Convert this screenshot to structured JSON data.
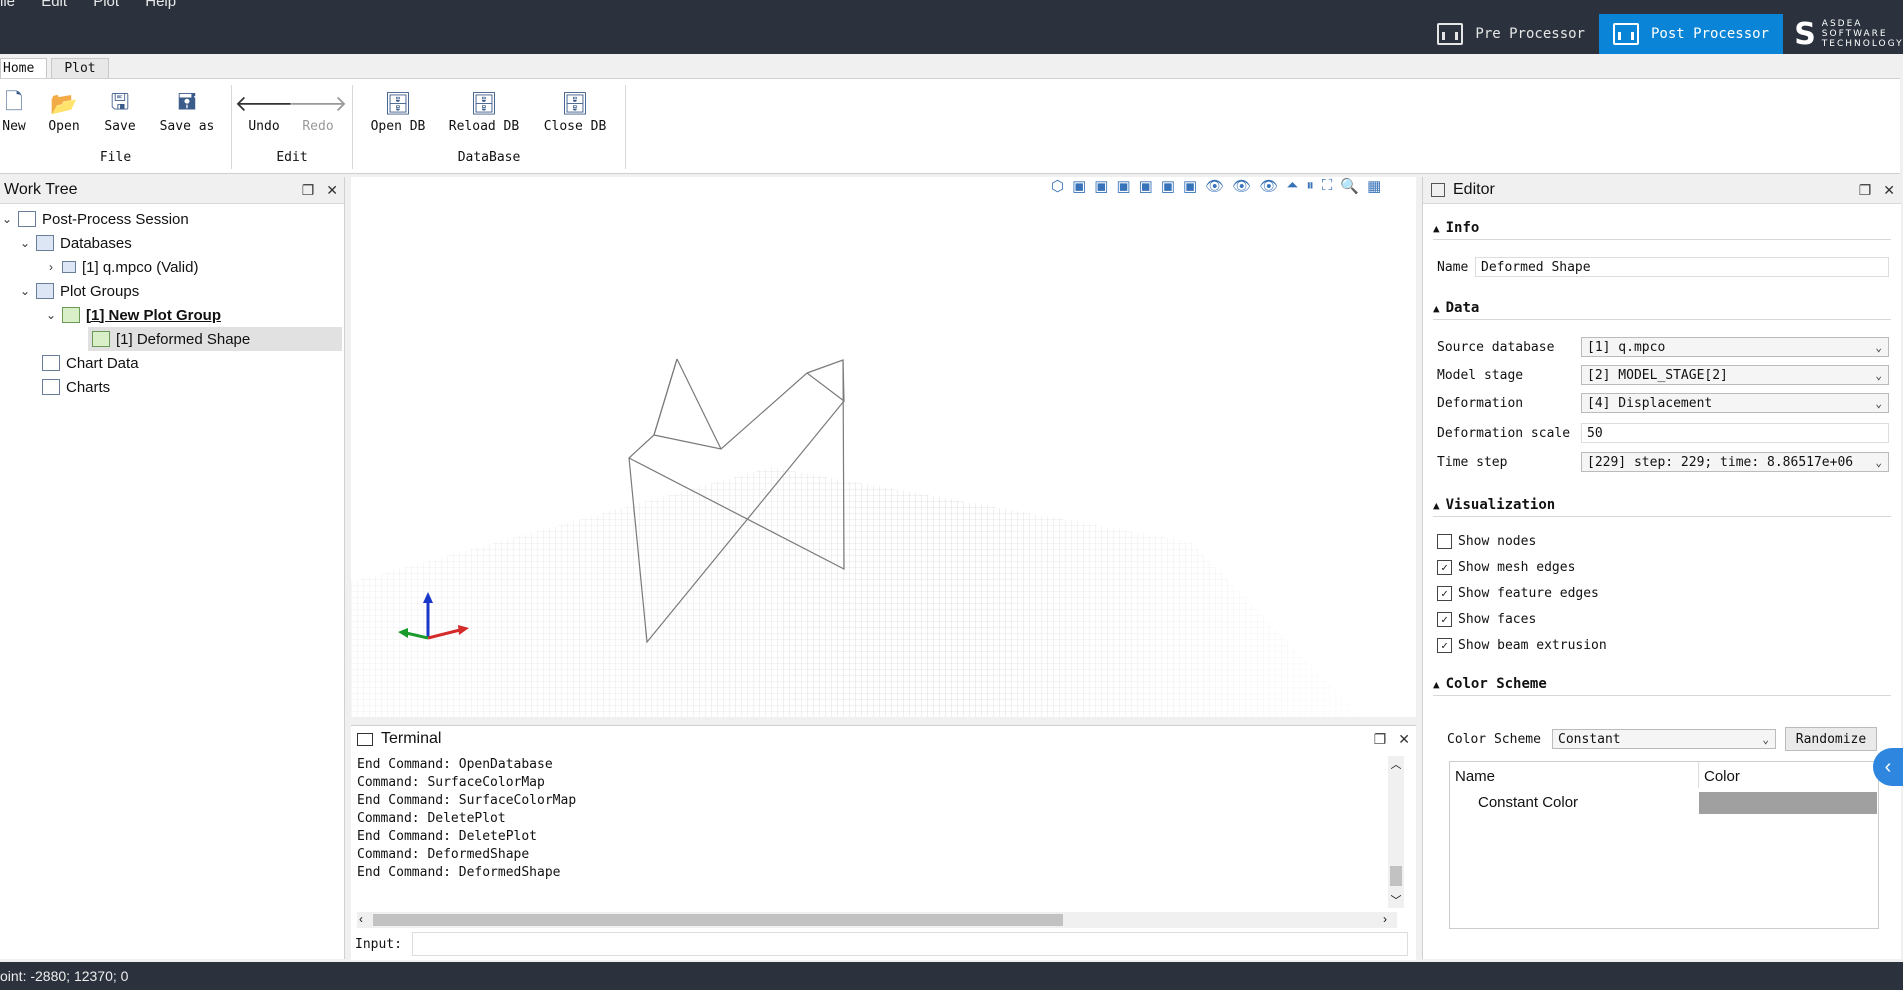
{
  "menu": [
    "ile",
    "Edit",
    "Plot",
    "Help"
  ],
  "processors": {
    "pre": "Pre Processor",
    "post": "Post Processor",
    "logo_text": "ASDEA SOFTWARE TECHNOLOGY"
  },
  "ribbon_tabs": [
    "Home",
    "Plot"
  ],
  "ribbon": {
    "file_group": "File",
    "edit_group": "Edit",
    "db_group": "DataBase",
    "new": "New",
    "open": "Open",
    "save": "Save",
    "save_as": "Save as",
    "undo": "Undo",
    "redo": "Redo",
    "open_db": "Open DB",
    "reload_db": "Reload DB",
    "close_db": "Close DB"
  },
  "worktree": {
    "title": "Work Tree",
    "session": "Post-Process Session",
    "databases": "Databases",
    "db_item": "[1] q.mpco (Valid)",
    "plot_groups": "Plot Groups",
    "plot_group": "[1] New Plot Group",
    "plot": "[1] Deformed Shape",
    "chart_data": "Chart Data",
    "charts": "Charts"
  },
  "terminal": {
    "title": "Terminal",
    "lines": [
      "End Command: OpenDatabase",
      "Command: SurfaceColorMap",
      "End Command: SurfaceColorMap",
      "Command: DeletePlot",
      "End Command: DeletePlot",
      "Command: DeformedShape",
      "End Command: DeformedShape"
    ],
    "input_label": "Input:"
  },
  "editor": {
    "title": "Editor",
    "info": "Info",
    "name_label": "Name",
    "name_value": "Deformed Shape",
    "data": "Data",
    "source_db_label": "Source database",
    "source_db_value": "[1] q.mpco",
    "model_stage_label": "Model stage",
    "model_stage_value": "[2] MODEL_STAGE[2]",
    "deformation_label": "Deformation",
    "deformation_value": "[4] Displacement",
    "scale_label": "Deformation scale",
    "scale_value": "50",
    "time_step_label": "Time step",
    "time_step_value": "[229] step: 229; time: 8.86517e+06",
    "visualization": "Visualization",
    "show_nodes": "Show nodes",
    "show_mesh_edges": "Show mesh edges",
    "show_feature_edges": "Show feature edges",
    "show_faces": "Show faces",
    "show_beam_extrusion": "Show beam extrusion",
    "color_scheme_section": "Color Scheme",
    "color_scheme_label": "Color Scheme",
    "color_scheme_value": "Constant",
    "randomize": "Randomize",
    "col_name": "Name",
    "col_color": "Color",
    "row_name": "Constant Color",
    "row_color": "#a0a0a0"
  },
  "checks": {
    "show_nodes": false,
    "show_mesh_edges": true,
    "show_feature_edges": true,
    "show_faces": true,
    "show_beam_extrusion": true
  },
  "status": "oint: -2880; 12370; 0",
  "colors": {
    "accent": "#0a84d6",
    "dark_bar": "#2b323d"
  }
}
